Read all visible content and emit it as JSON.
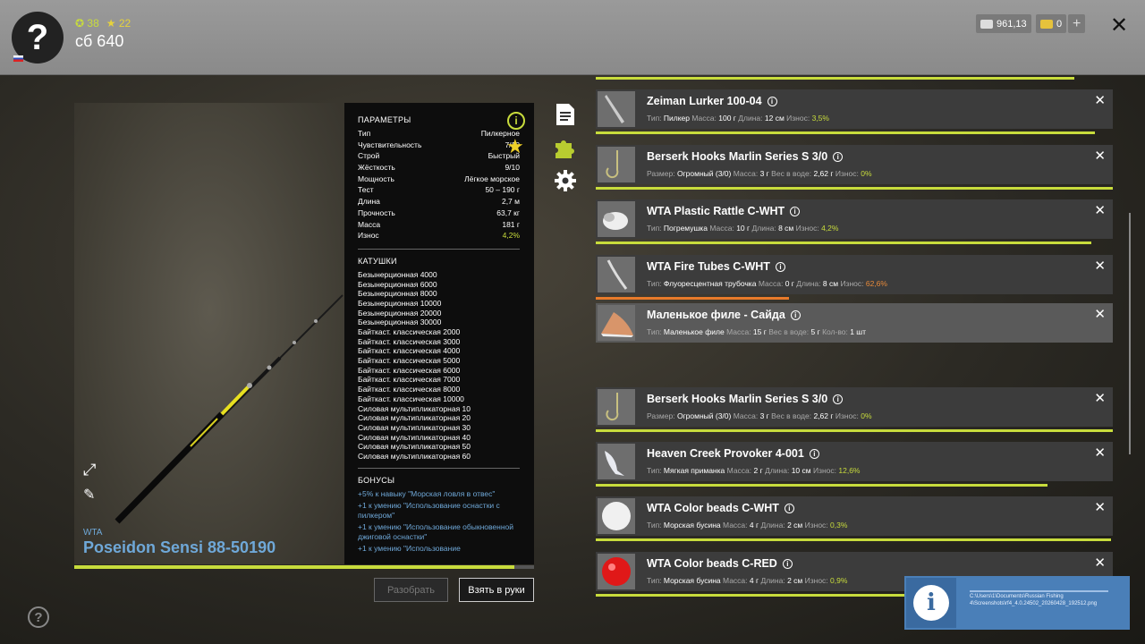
{
  "header": {
    "avatar": "?",
    "stat1": "38",
    "stat2": "22",
    "username": "сб 640",
    "money": "961,13",
    "gold": "0",
    "plus": "+",
    "close": "✕"
  },
  "rod": {
    "brand": "WTA",
    "name": "Poseidon Sensi 88-50190",
    "durability_fraction": 0.957
  },
  "params": {
    "title": "ПАРАМЕТРЫ",
    "rows": [
      {
        "k": "Тип",
        "v": "Пилкерное"
      },
      {
        "k": "Чувствительность",
        "v": "7/10"
      },
      {
        "k": "Строй",
        "v": "Быстрый"
      },
      {
        "k": "Жёсткость",
        "v": "9/10"
      },
      {
        "k": "Мощность",
        "v": "Лёгкое морское"
      },
      {
        "k": "Тест",
        "v": "50 – 190 г"
      },
      {
        "k": "Длина",
        "v": "2,7 м"
      },
      {
        "k": "Прочность",
        "v": "63,7 кг"
      },
      {
        "k": "Масса",
        "v": "181 г"
      },
      {
        "k": "Износ",
        "v": "4,2%"
      }
    ],
    "reels_title": "КАТУШКИ",
    "reels": [
      "Безынерционная 4000",
      "Безынерционная 6000",
      "Безынерционная 8000",
      "Безынерционная 10000",
      "Безынерционная 20000",
      "Безынерционная 30000",
      "Байткаст. классическая 2000",
      "Байткаст. классическая 3000",
      "Байткаст. классическая 4000",
      "Байткаст. классическая 5000",
      "Байткаст. классическая 6000",
      "Байткаст. классическая 7000",
      "Байткаст. классическая 8000",
      "Байткаст. классическая 10000",
      "Силовая мультипликаторная 10",
      "Силовая мультипликаторная 20",
      "Силовая мультипликаторная 30",
      "Силовая мультипликаторная 40",
      "Силовая мультипликаторная 50",
      "Силовая мультипликаторная 60"
    ],
    "bonuses_title": "БОНУСЫ",
    "bonuses": [
      "+5% к навыку \"Морская ловля в отвес\"",
      "+1 к умению \"Использование оснастки с пилкером\"",
      "+1 к умению \"Использование обыкновенной джиговой оснастки\"",
      "+1 к умению \"Использование"
    ],
    "info": "i"
  },
  "buttons": {
    "disassemble": "Разобрать",
    "take": "Взять в руки"
  },
  "help": "?",
  "items": [
    {
      "name": "Zeiman Lurker 100-04",
      "close": "✕",
      "desc": [
        [
          "Тип:",
          "Пилкер"
        ],
        [
          "Масса:",
          "100 г"
        ],
        [
          "Длина:",
          "12 см"
        ],
        [
          "Износ:",
          "3,5%"
        ]
      ],
      "wear_color": "g",
      "bar": 0.965,
      "bar_color": "#c8dc3c"
    },
    {
      "name": "Berserk Hooks Marlin Series S 3/0",
      "close": "✕",
      "desc": [
        [
          "Размер:",
          "Огромный (3/0)"
        ],
        [
          "Масса:",
          "3 г"
        ],
        [
          "Вес в воде:",
          "2,62 г"
        ],
        [
          "Износ:",
          "0%"
        ]
      ],
      "wear_color": "g",
      "bar": 1.0,
      "bar_color": "#c8dc3c"
    },
    {
      "name": "WTA Plastic Rattle C-WHT",
      "close": "✕",
      "desc": [
        [
          "Тип:",
          "Погремушка"
        ],
        [
          "Масса:",
          "10 г"
        ],
        [
          "Длина:",
          "8 см"
        ],
        [
          "Износ:",
          "4,2%"
        ]
      ],
      "wear_color": "g",
      "bar": 0.958,
      "bar_color": "#c8dc3c"
    },
    {
      "name": "WTA Fire Tubes C-WHT",
      "close": "✕",
      "desc": [
        [
          "Тип:",
          "Флуоресцентная трубочка"
        ],
        [
          "Масса:",
          "0 г"
        ],
        [
          "Длина:",
          "8 см"
        ],
        [
          "Износ:",
          "62,6%"
        ]
      ],
      "wear_color": "o",
      "bar": 0.374,
      "bar_color": "#e87a2a"
    },
    {
      "name": "Маленькое филе - Сайда",
      "close": "✕",
      "desc": [
        [
          "Тип:",
          "Маленькое филе"
        ],
        [
          "Масса:",
          "15 г"
        ],
        [
          "Вес в воде:",
          "5 г"
        ],
        [
          "Кол-во:",
          "1 шт"
        ]
      ],
      "wear_color": "",
      "bar": 0,
      "bar_color": "#c8dc3c"
    },
    {
      "name": "Berserk Hooks Marlin Series S 3/0",
      "close": "✕",
      "desc": [
        [
          "Размер:",
          "Огромный (3/0)"
        ],
        [
          "Масса:",
          "3 г"
        ],
        [
          "Вес в воде:",
          "2,62 г"
        ],
        [
          "Износ:",
          "0%"
        ]
      ],
      "wear_color": "g",
      "bar": 1.0,
      "bar_color": "#c8dc3c"
    },
    {
      "name": "Heaven Creek Provoker 4-001",
      "close": "✕",
      "desc": [
        [
          "Тип:",
          "Мягкая приманка"
        ],
        [
          "Масса:",
          "2 г"
        ],
        [
          "Длина:",
          "10 см"
        ],
        [
          "Износ:",
          "12,6%"
        ]
      ],
      "wear_color": "g",
      "bar": 0.874,
      "bar_color": "#c8dc3c"
    },
    {
      "name": "WTA Color beads C-WHT",
      "close": "✕",
      "desc": [
        [
          "Тип:",
          "Морская бусина"
        ],
        [
          "Масса:",
          "4 г"
        ],
        [
          "Длина:",
          "2 см"
        ],
        [
          "Износ:",
          "0,3%"
        ]
      ],
      "wear_color": "g",
      "bar": 0.997,
      "bar_color": "#c8dc3c"
    },
    {
      "name": "WTA Color beads C-RED",
      "close": "✕",
      "desc": [
        [
          "Тип:",
          "Морская бусина"
        ],
        [
          "Масса:",
          "4 г"
        ],
        [
          "Длина:",
          "2 см"
        ],
        [
          "Износ:",
          "0,9%"
        ]
      ],
      "wear_color": "g",
      "bar": 0.991,
      "bar_color": "#c8dc3c"
    }
  ],
  "notification": {
    "icon": "i",
    "text": "C:\\Users\\1\\Documents\\Russian Fishing 4\\Screenshots\\rf4_4.0.24502_20260428_192512.png"
  }
}
